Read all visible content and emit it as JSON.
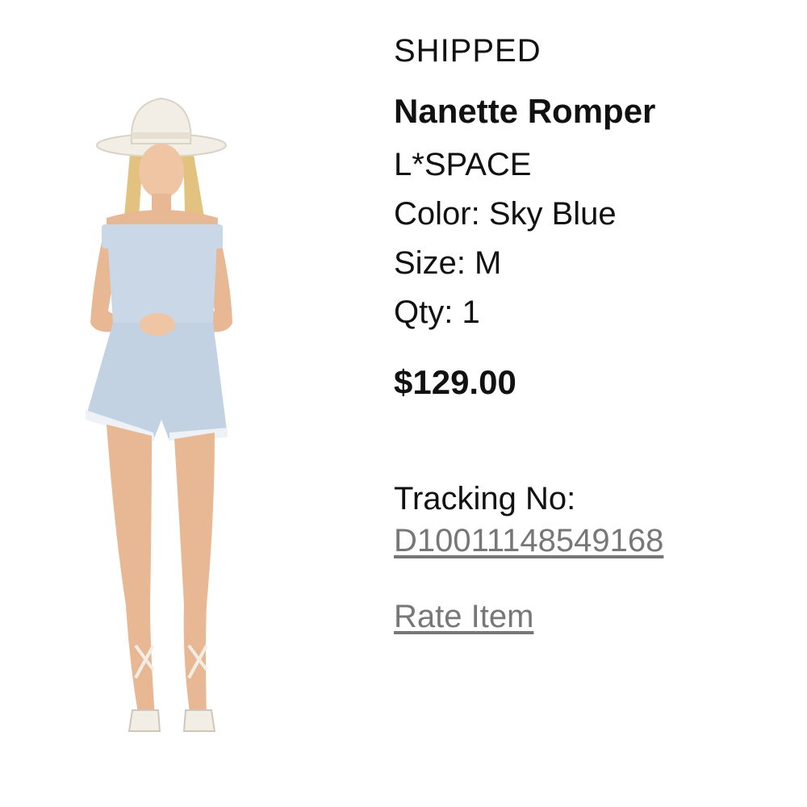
{
  "order_item": {
    "status": "SHIPPED",
    "product_name": "Nanette Romper",
    "brand": "L*SPACE",
    "color_line": "Color: Sky Blue",
    "size_line": "Size: M",
    "qty_line": "Qty: 1",
    "price": "$129.00",
    "tracking_label": "Tracking No:",
    "tracking_number": "D10011148549168",
    "rate_item_label": "Rate Item"
  },
  "colors": {
    "text": "#111111",
    "link": "#777777",
    "romper": "#c9d7e6",
    "hat": "#f2eee6",
    "skin": "#e8b894"
  }
}
